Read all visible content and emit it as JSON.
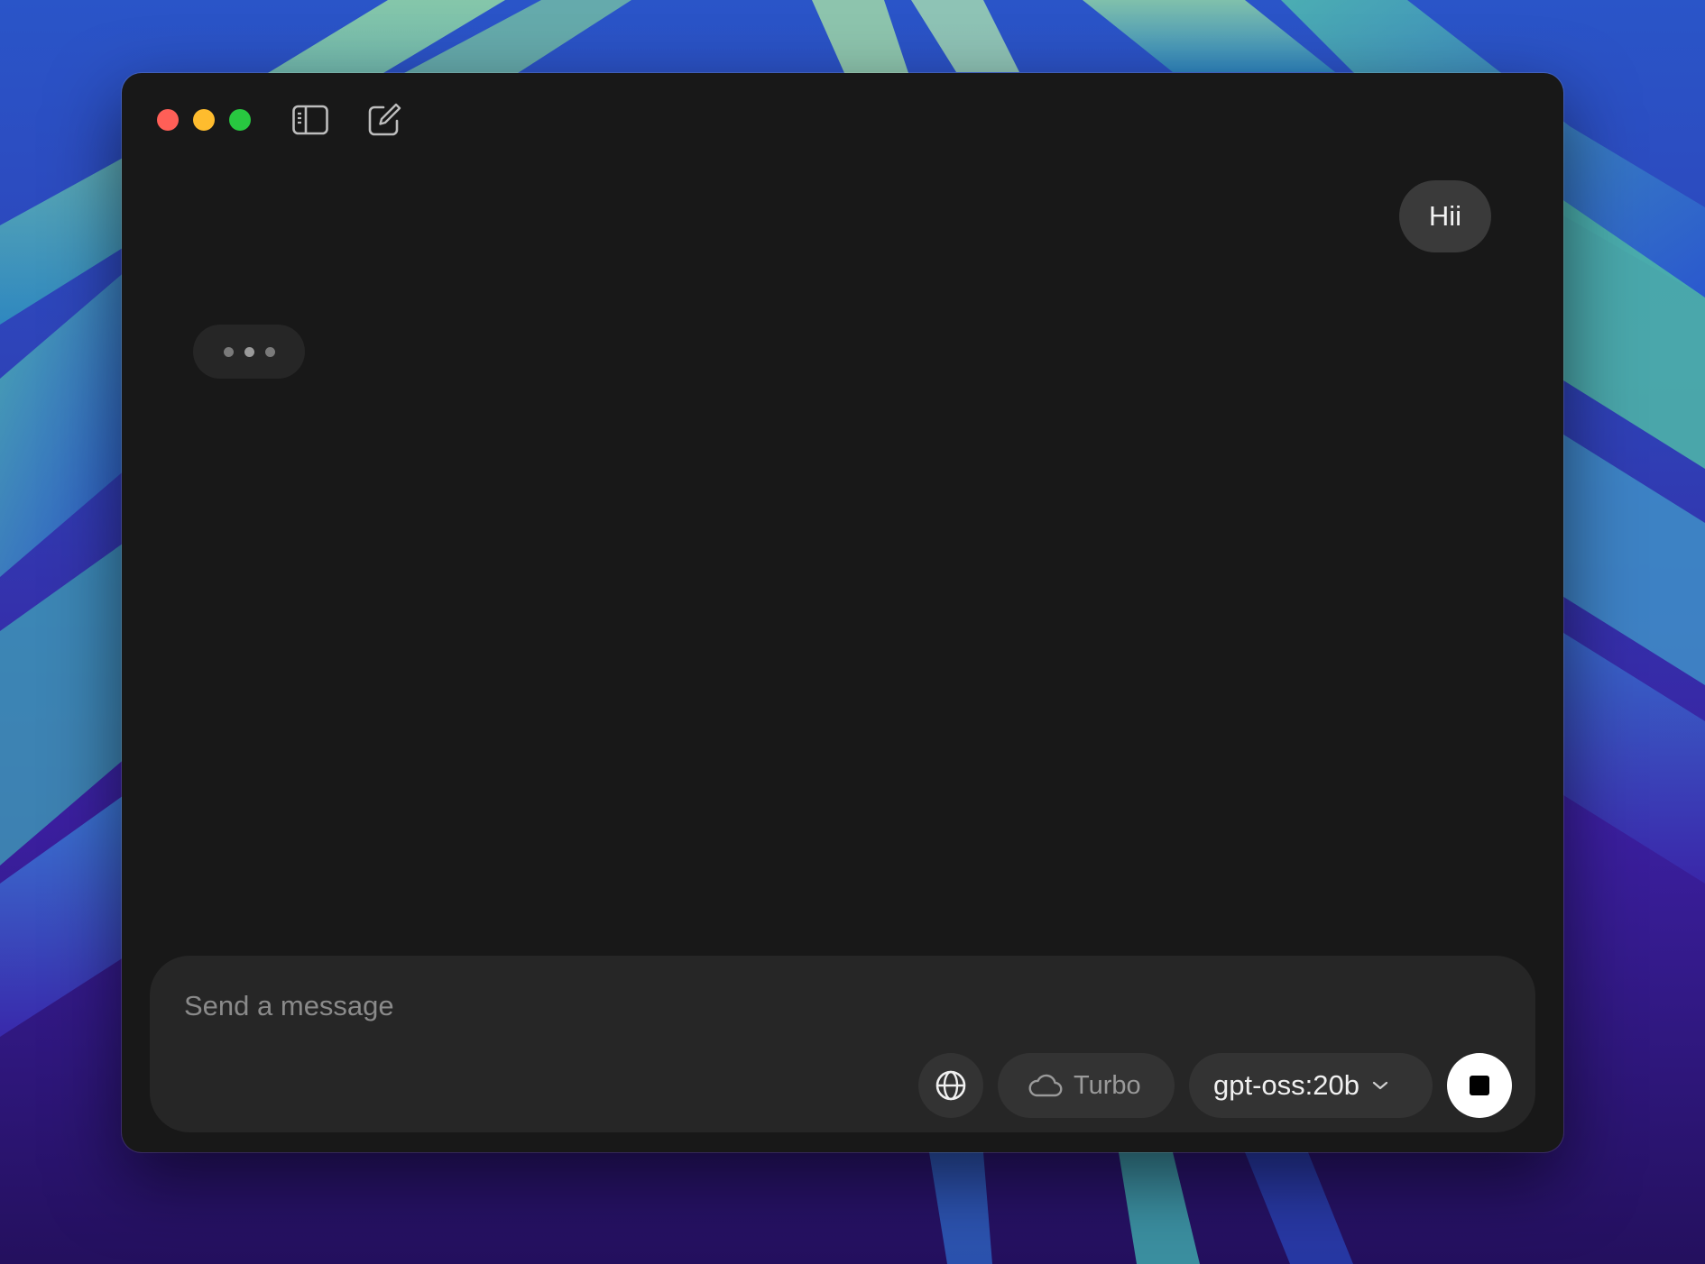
{
  "window": {
    "controls": {
      "close_color": "#ff5f57",
      "minimize_color": "#febc2e",
      "maximize_color": "#28c840"
    },
    "toolbar": {
      "sidebar_icon": "sidebar-toggle-icon",
      "compose_icon": "new-chat-icon"
    }
  },
  "conversation": {
    "messages": [
      {
        "role": "user",
        "text": "Hii"
      }
    ],
    "assistant_typing": true
  },
  "composer": {
    "placeholder": "Send a message",
    "value": "",
    "web_search_icon": "globe-icon",
    "turbo": {
      "icon": "cloud-icon",
      "label": "Turbo"
    },
    "model": {
      "label": "gpt-oss:20b",
      "icon": "chevron-down-icon"
    },
    "stop_icon": "stop-icon"
  },
  "colors": {
    "window_bg": "#181818",
    "composer_bg": "#262626",
    "pill_bg": "#333333",
    "user_bubble_bg": "#3a3a3a"
  }
}
